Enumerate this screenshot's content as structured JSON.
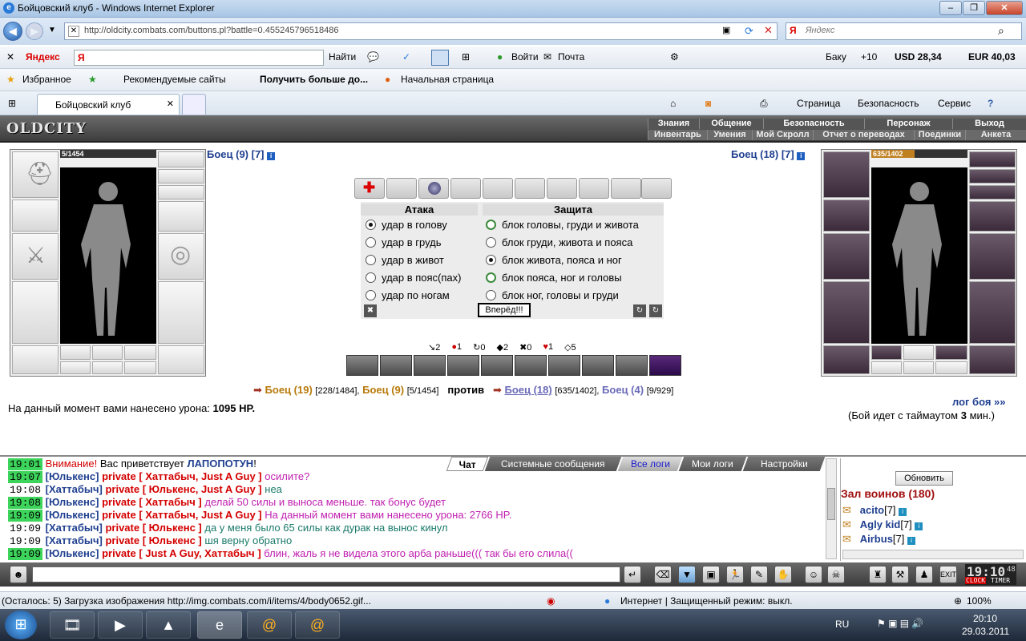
{
  "window": {
    "title": "Бойцовский клуб - Windows Internet Explorer"
  },
  "address": {
    "url": "http://oldcity.combats.com/buttons.pl?battle=0.455245796518486",
    "search_placeholder": "Яндекс"
  },
  "yandex_bar": {
    "brand": "Яндекс",
    "input": "Я",
    "find": "Найти",
    "login": "Войти",
    "mail": "Почта",
    "city": "Баку",
    "temp": "+10",
    "usd": "USD 28,34",
    "eur": "EUR 40,03"
  },
  "favorites": {
    "fav": "Избранное",
    "rec": "Рекомендуемые сайты",
    "more": "Получить больше до...",
    "home": "Начальная страница"
  },
  "tabs": {
    "active": "Бойцовский клуб",
    "page": "Страница",
    "safety": "Безопасность",
    "service": "Сервис"
  },
  "game": {
    "logo": "OLDCITY",
    "menu_top": [
      "Знания",
      "Общение",
      "Безопасность",
      "Персонаж",
      "Выход"
    ],
    "menu_bottom": [
      "Инвентарь",
      "Умения",
      "Мой Скролл",
      "Отчет о переводах",
      "Поединки",
      "Анкета"
    ],
    "left_hp": "5/1454",
    "right_hp": "635/1402",
    "left_name": "Боец (9) [7]",
    "right_name": "Боец (18) [7]",
    "attack_title": "Атака",
    "defense_title": "Защита",
    "attacks": [
      "удар в голову",
      "удар в грудь",
      "удар в живот",
      "удар в пояс(пах)",
      "удар по ногам"
    ],
    "defenses": [
      "блок головы, груди и живота",
      "блок груди, живота и пояса",
      "блок живота, пояса и ног",
      "блок пояса, ног и головы",
      "блок ног, головы и груди"
    ],
    "forward": "Вперёд!!!",
    "stats": [
      "2",
      "1",
      "0",
      "2",
      "0",
      "1",
      "5"
    ],
    "team1a": "Боец (19)",
    "team1a_hp": "[228/1484],",
    "team1b": "Боец (9)",
    "team1b_hp": "[5/1454]",
    "vs": "против",
    "team2a": "Боец (18)",
    "team2a_hp": "[635/1402],",
    "team2b": "Боец (4)",
    "team2b_hp": "[9/929]",
    "damage_label": "На данный момент вами нанесено урона:",
    "damage_value": "1095 HP.",
    "log_link": "лог боя »»",
    "timeout_pre": "(Бой идет с таймаутом",
    "timeout_val": "3",
    "timeout_post": "мин.)"
  },
  "chat": {
    "tabs": [
      "Чат",
      "Системные сообщения",
      "Все логи",
      "Мои логи",
      "Настройки"
    ],
    "refresh": "Обновить",
    "hall": "Зал воинов (180)",
    "users": [
      {
        "name": "acito",
        "lvl": "[7]"
      },
      {
        "name": "Agly kid",
        "lvl": "[7]"
      },
      {
        "name": "Airbus",
        "lvl": "[7]"
      }
    ],
    "lines": [
      {
        "t": "19:01",
        "a": "Внимание!",
        "b": " Вас приветствует ",
        "c": "ЛАПОПОТУН",
        "d": "!"
      },
      {
        "t": "19:07",
        "n": "[Юлькенс]",
        "p": "private [ Хаттабыч, Just A Guy ]",
        "m": "осилите?",
        "cls": "mg"
      },
      {
        "t": "19:08",
        "n": "[Хаттабыч]",
        "p": "private [ Юлькенс, Just A Guy ]",
        "m": "неа",
        "cls": "gr"
      },
      {
        "t": "19:08",
        "n": "[Юлькенс]",
        "p": "private [ Хаттабыч ]",
        "m": "делай 50 силы и выноса меньше. так бонус будет",
        "cls": "mg"
      },
      {
        "t": "19:09",
        "n": "[Юлькенс]",
        "p": "private [ Хаттабыч, Just A Guy ]",
        "m": "На данный момент вами нанесено урона: 2766 HP.",
        "cls": "mg"
      },
      {
        "t": "19:09",
        "n": "[Хаттабыч]",
        "p": "private [ Юлькенс ]",
        "m": "да у меня было 65 силы как дурак на вынос кинул",
        "cls": "gr"
      },
      {
        "t": "19:09",
        "n": "[Хаттабыч]",
        "p": "private [ Юлькенс ]",
        "m": "шя верну обратно",
        "cls": "gr"
      },
      {
        "t": "19:09",
        "n": "[Юлькенс]",
        "p": "private [ Just A Guy, Хаттабыч ]",
        "m": "блин, жаль я не видела этого арба раньше((( так бы его слила((",
        "cls": "mg"
      }
    ],
    "clock": "19:10",
    "clock_sec": "48",
    "clock_label": "CLOCK",
    "timer_label": "TIMER"
  },
  "status": {
    "text": "(Осталось: 5) Загрузка изображения http://img.combats.com/i/items/4/body0652.gif...",
    "zone": "Интернет | Защищенный режим: выкл.",
    "zoom": "100%"
  },
  "taskbar": {
    "lang": "RU",
    "time": "20:10",
    "date": "29.03.2011"
  }
}
